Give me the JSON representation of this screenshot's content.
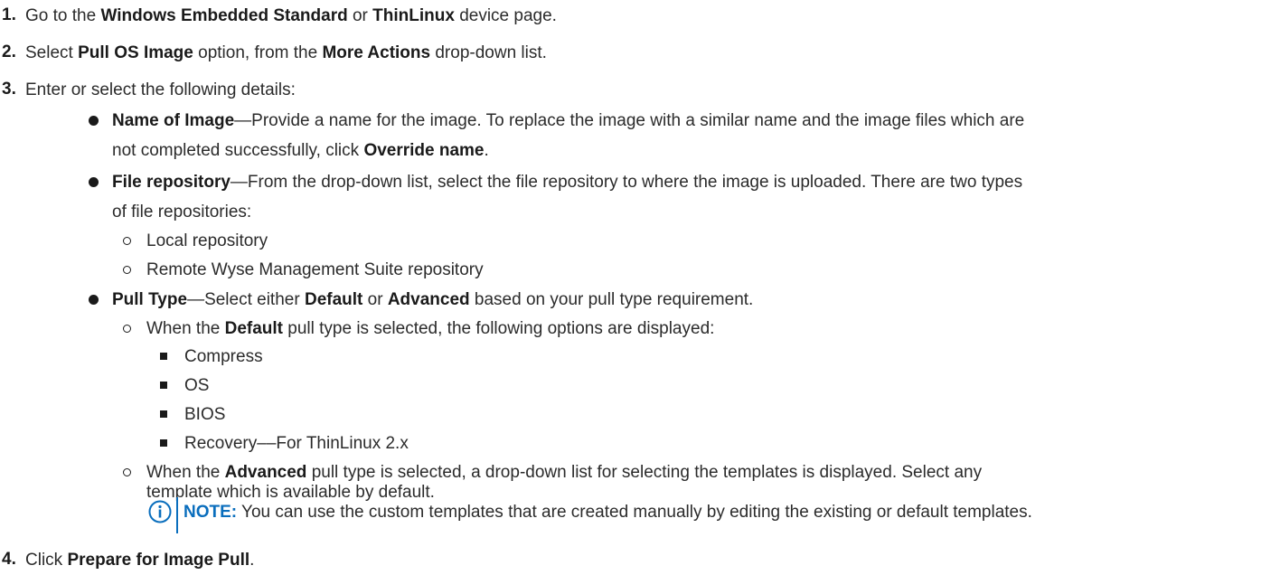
{
  "steps": [
    {
      "num": "1.",
      "parts": [
        "Go to the ",
        "Windows Embedded Standard",
        " or ",
        "ThinLinux",
        " device page."
      ]
    },
    {
      "num": "2.",
      "parts": [
        "Select ",
        "Pull OS Image",
        " option, from the ",
        "More Actions",
        " drop-down list."
      ]
    },
    {
      "num": "3.",
      "text": "Enter or select the following details:"
    },
    {
      "num": "4.",
      "parts": [
        "Click ",
        "Prepare for Image Pull",
        "."
      ]
    }
  ],
  "details": {
    "name_of_image": {
      "label": "Name of Image",
      "line1": "—Provide a name for the image. To replace the image with a similar name and the image files which are",
      "line2_pre": "not completed successfully, click ",
      "line2_bold": "Override name",
      "line2_post": "."
    },
    "file_repository": {
      "label": "File repository",
      "line1": "—From the drop-down list, select the file repository to where the image is uploaded. There are two types",
      "line2": "of file repositories:",
      "types": [
        "Local repository",
        "Remote Wyse Management Suite repository"
      ]
    },
    "pull_type": {
      "label": "Pull Type",
      "parts": [
        "—Select either ",
        "Default",
        " or ",
        "Advanced",
        " based on your pull type requirement."
      ],
      "default_parts": [
        "When the ",
        "Default",
        " pull type is selected, the following options are displayed:"
      ],
      "default_options": [
        "Compress",
        "OS",
        "BIOS",
        "Recovery––For ThinLinux 2.x"
      ],
      "advanced_parts": [
        "When the ",
        "Advanced",
        " pull type is selected, a drop-down list for selecting the templates is displayed. Select any"
      ],
      "advanced_line2": "template which is available by default."
    }
  },
  "note": {
    "label": "NOTE:",
    "text": " You can use the custom templates that are created manually by editing the existing or default templates."
  },
  "colors": {
    "text": "#2b2b2b",
    "note_accent": "#0a6ebd"
  },
  "icons": {
    "note": "info-circle-icon"
  }
}
